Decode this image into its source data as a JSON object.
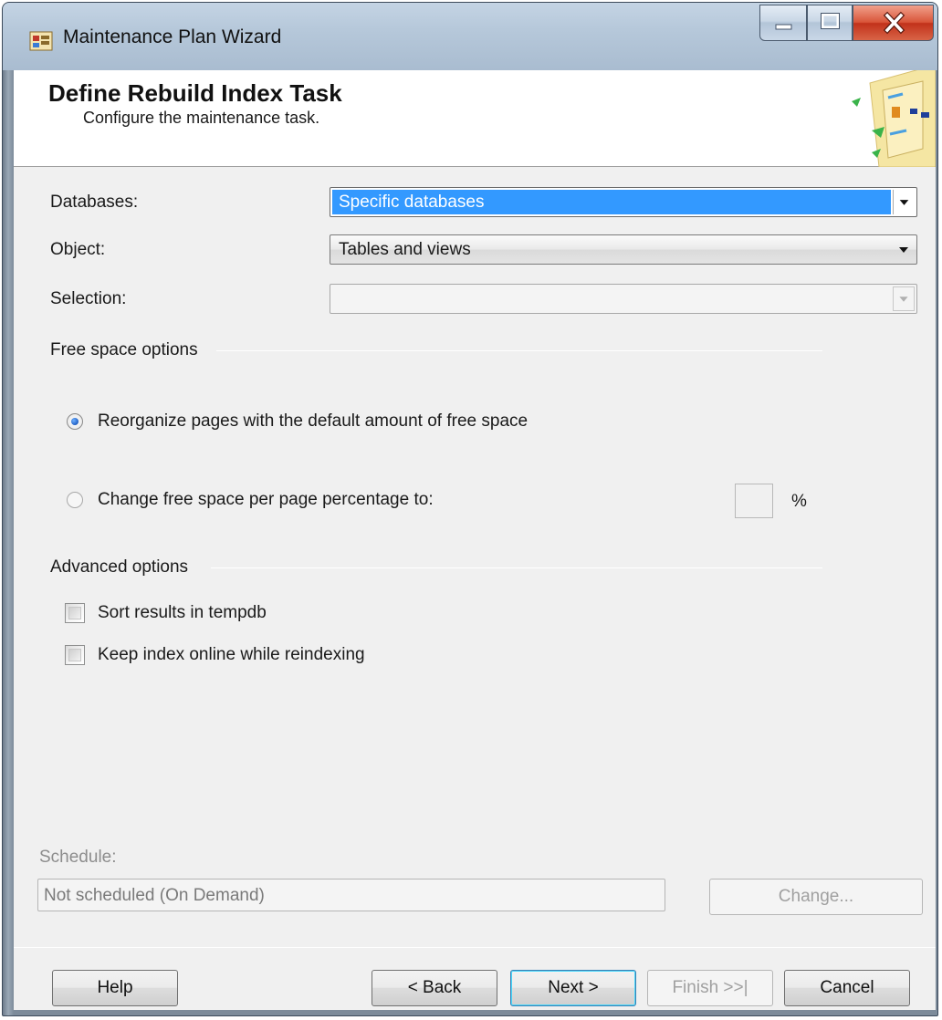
{
  "window": {
    "title": "Maintenance Plan Wizard"
  },
  "header": {
    "title": "Define Rebuild Index Task",
    "subtitle": "Configure the maintenance task."
  },
  "form": {
    "databases": {
      "label": "Databases:",
      "value": "Specific databases"
    },
    "object": {
      "label": "Object:",
      "value": "Tables and views"
    },
    "selection": {
      "label": "Selection:",
      "value": ""
    }
  },
  "free_space": {
    "group_label": "Free space options",
    "option_default": "Reorganize pages with the default amount of free space",
    "option_change": "Change free space per page percentage to:",
    "selected": "default",
    "percent_value": "",
    "percent_unit": "%"
  },
  "advanced": {
    "group_label": "Advanced options",
    "sort_in_tempdb": {
      "label": "Sort results in tempdb",
      "checked": false
    },
    "keep_online": {
      "label": "Keep index online while reindexing",
      "checked": false
    }
  },
  "schedule": {
    "label": "Schedule:",
    "value": "Not scheduled (On Demand)",
    "change_button": "Change..."
  },
  "buttons": {
    "help": "Help",
    "back": "< Back",
    "next": "Next >",
    "finish": "Finish >>|",
    "cancel": "Cancel"
  },
  "colors": {
    "selection_highlight": "#3399ff",
    "client_background": "#f0f0f0",
    "close_button": "#c2321b"
  }
}
